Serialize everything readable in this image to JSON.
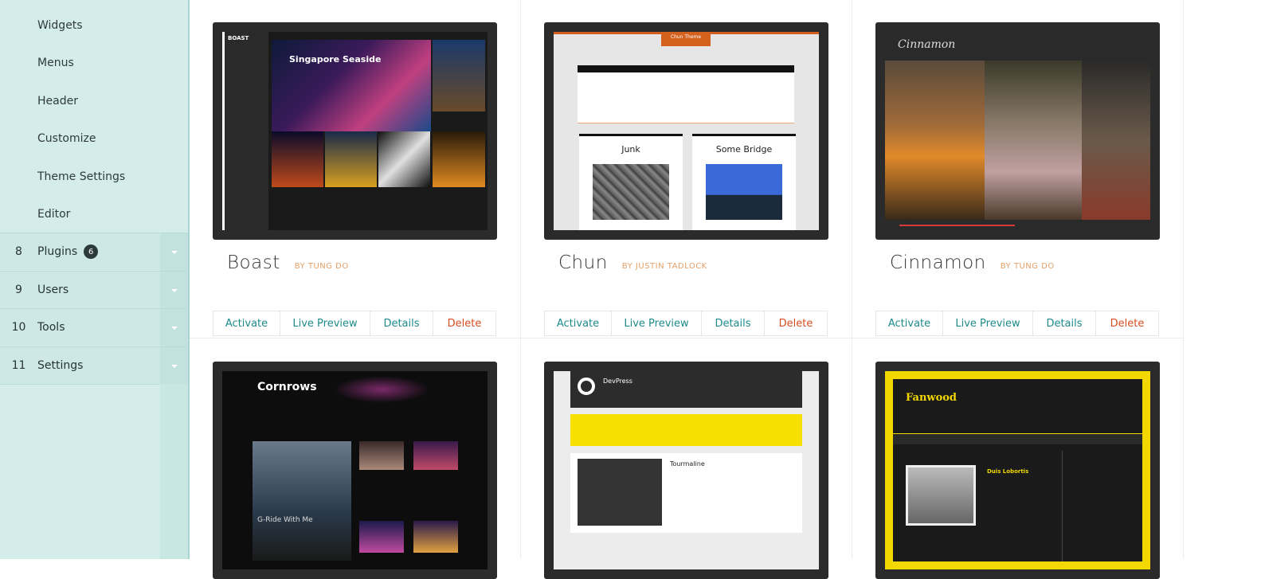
{
  "sidebar": {
    "subitems": [
      "Widgets",
      "Menus",
      "Header",
      "Customize",
      "Theme Settings",
      "Editor"
    ],
    "items": [
      {
        "num": "8",
        "label": "Plugins",
        "badge": "6"
      },
      {
        "num": "9",
        "label": "Users",
        "badge": ""
      },
      {
        "num": "10",
        "label": "Tools",
        "badge": ""
      },
      {
        "num": "11",
        "label": "Settings",
        "badge": ""
      }
    ]
  },
  "themes": [
    {
      "name": "Boast",
      "by": "BY TUNG DO",
      "shot_title": "Singapore Seaside",
      "shot_brand": "BOAST"
    },
    {
      "name": "Chun",
      "by": "BY JUSTIN TADLOCK",
      "shot_tag": "Chun Theme",
      "box1": "Junk",
      "box2": "Some Bridge"
    },
    {
      "name": "Cinnamon",
      "by": "BY TUNG DO",
      "shot_brand": "Cinnamon"
    },
    {
      "name": "Cornrows",
      "shot_brand": "Cornrows",
      "shot_caption": "G-Ride With Me"
    },
    {
      "name": "DevPress",
      "shot_brand": "DevPress",
      "shot_item": "Tourmaline"
    },
    {
      "name": "Fanwood",
      "shot_brand": "Fanwood",
      "shot_post": "Duis Lobortis"
    }
  ],
  "actions": {
    "activate": "Activate",
    "preview": "Live Preview",
    "details": "Details",
    "delete": "Delete"
  },
  "colors": {
    "sidebar": "#d4ecea",
    "link": "#1e8a8a",
    "delete": "#d54e21",
    "author": "#e3a067"
  }
}
